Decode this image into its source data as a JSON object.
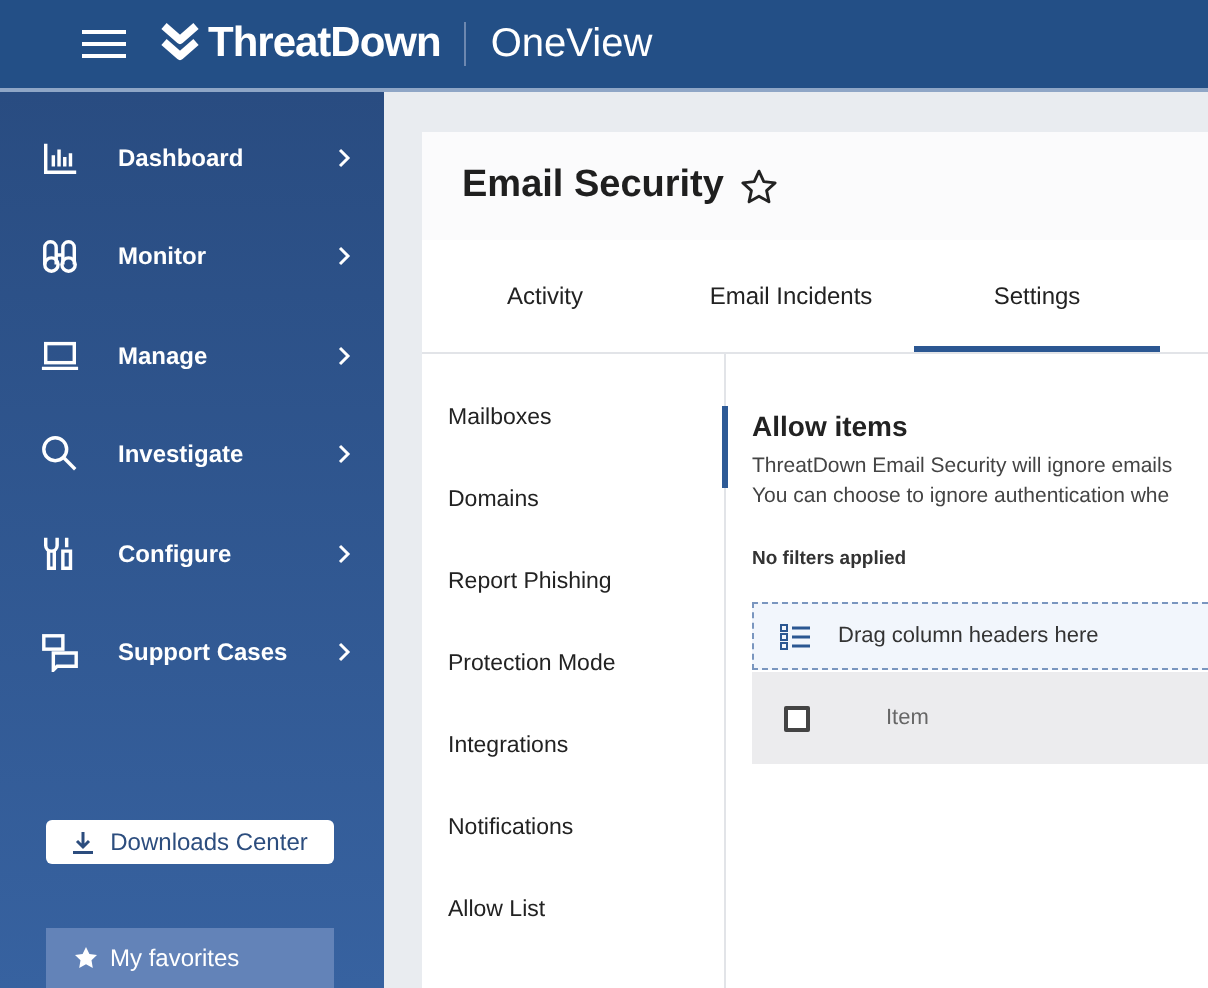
{
  "topbar": {
    "brand": "ThreatDown",
    "product": "OneView"
  },
  "sidebar": {
    "items": [
      {
        "label": "Dashboard"
      },
      {
        "label": "Monitor"
      },
      {
        "label": "Manage"
      },
      {
        "label": "Investigate"
      },
      {
        "label": "Configure"
      },
      {
        "label": "Support Cases"
      }
    ],
    "downloads_button": "Downloads Center",
    "favorites": "My favorites"
  },
  "page": {
    "title": "Email Security",
    "tabs": [
      {
        "label": "Activity",
        "selected": false
      },
      {
        "label": "Email Incidents",
        "selected": false
      },
      {
        "label": "Settings",
        "selected": true
      }
    ],
    "nav": [
      "Mailboxes",
      "Domains",
      "Report Phishing",
      "Protection Mode",
      "Integrations",
      "Notifications",
      "Allow List"
    ],
    "section": {
      "title": "Allow items",
      "description": [
        "ThreatDown Email Security will ignore emails",
        "You can choose to ignore authentication whe"
      ],
      "filters": "No filters applied",
      "group_zone": "Drag column headers here",
      "table": {
        "columns": [
          "Item"
        ],
        "select_all_checked": false
      }
    }
  }
}
